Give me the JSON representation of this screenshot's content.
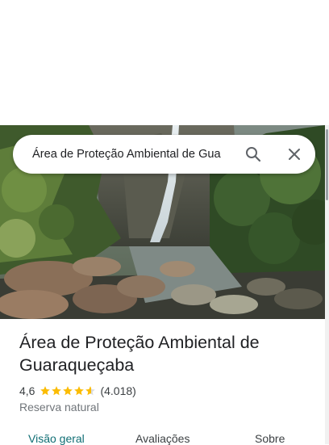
{
  "search": {
    "query": "Área de Proteção Ambiental de Gua",
    "search_icon": "search-icon",
    "close_icon": "close-icon"
  },
  "place": {
    "title": "Área de Proteção Ambiental de Guaraqueçaba",
    "rating": "4,6",
    "stars": 4.6,
    "review_count": "(4.018)",
    "category": "Reserva natural",
    "photo": "waterfall-photo"
  },
  "tabs": [
    {
      "label": "Visão geral",
      "active": true
    },
    {
      "label": "Avaliações",
      "active": false
    },
    {
      "label": "Sobre",
      "active": false
    }
  ],
  "colors": {
    "accent": "#0f6e74",
    "star": "#fbbc04",
    "text_primary": "#202124",
    "text_secondary": "#70757a"
  }
}
